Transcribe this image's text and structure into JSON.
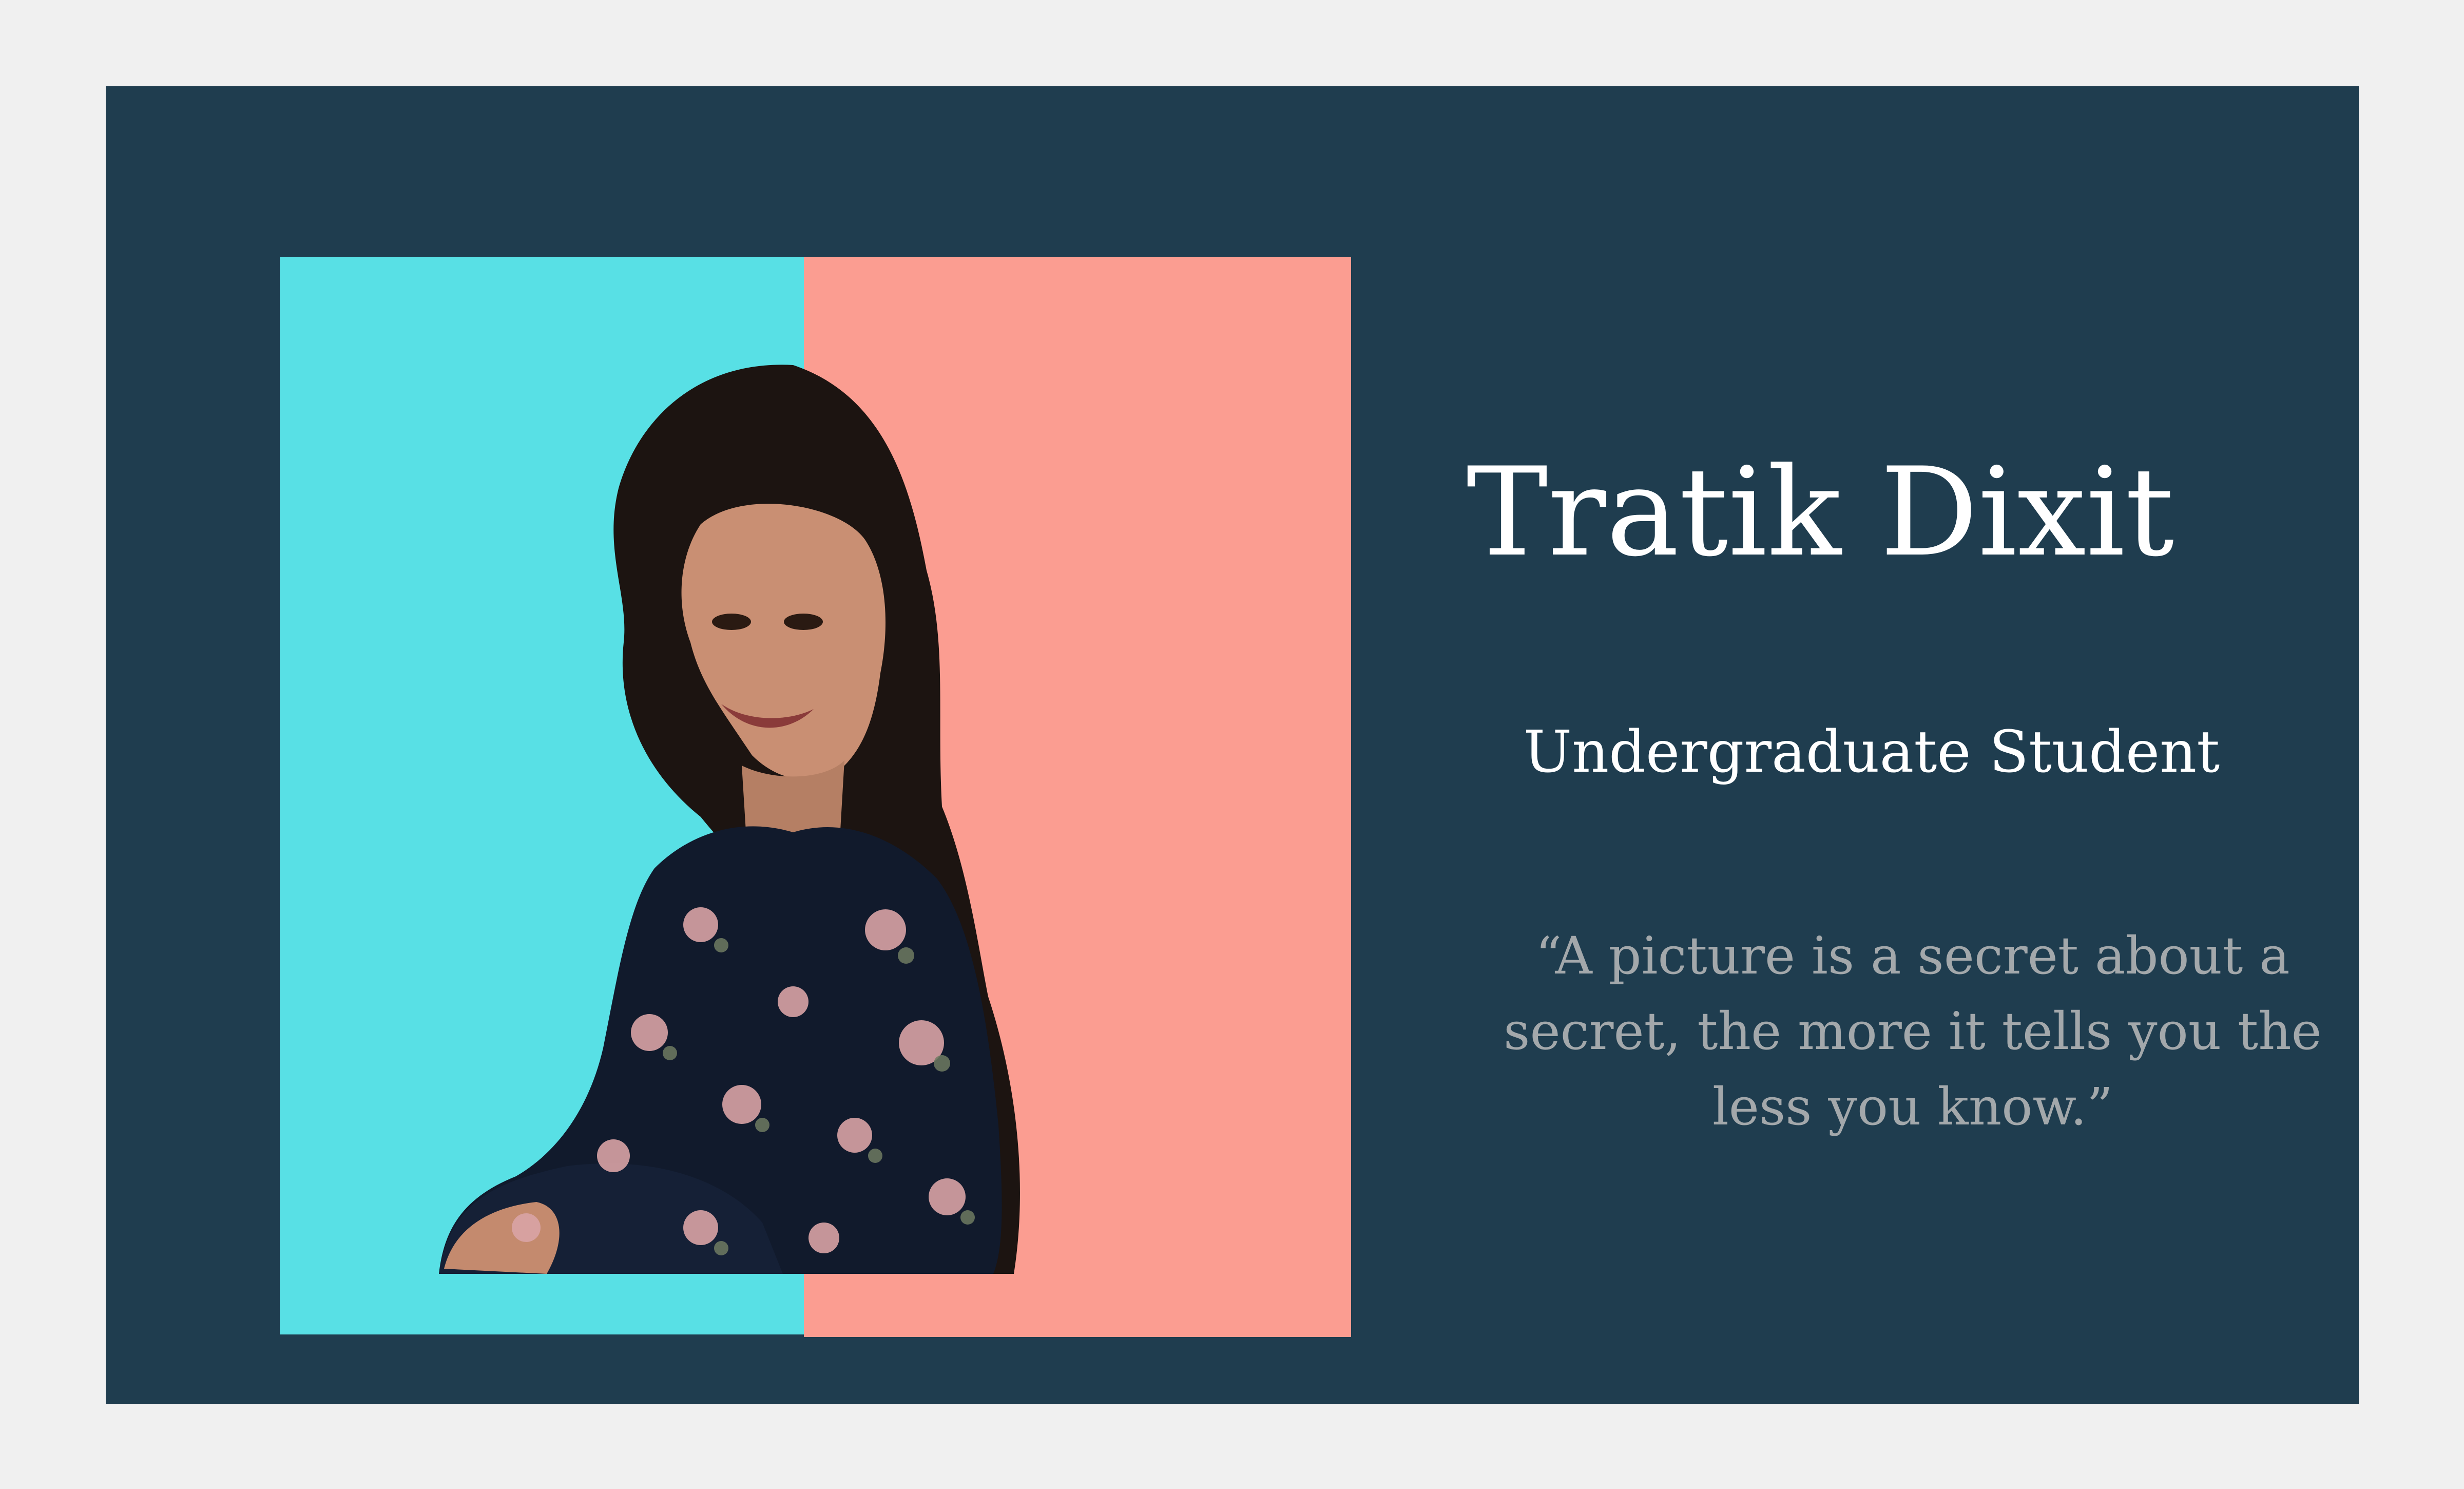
{
  "profile": {
    "name": "Tratik Dixit",
    "role": "Undergraduate Student",
    "quote": "“A picture is a secret about a secret, the more it tells you the less you know.”"
  },
  "colors": {
    "page_background": "#f0f0f0",
    "card_background": "#1f3d4f",
    "panel_left": "#58e0e5",
    "panel_right": "#fb9d91",
    "name_text": "#ffffff",
    "quote_text": "#a3a8ab"
  },
  "icons": {
    "portrait": "person-portrait-photo"
  }
}
